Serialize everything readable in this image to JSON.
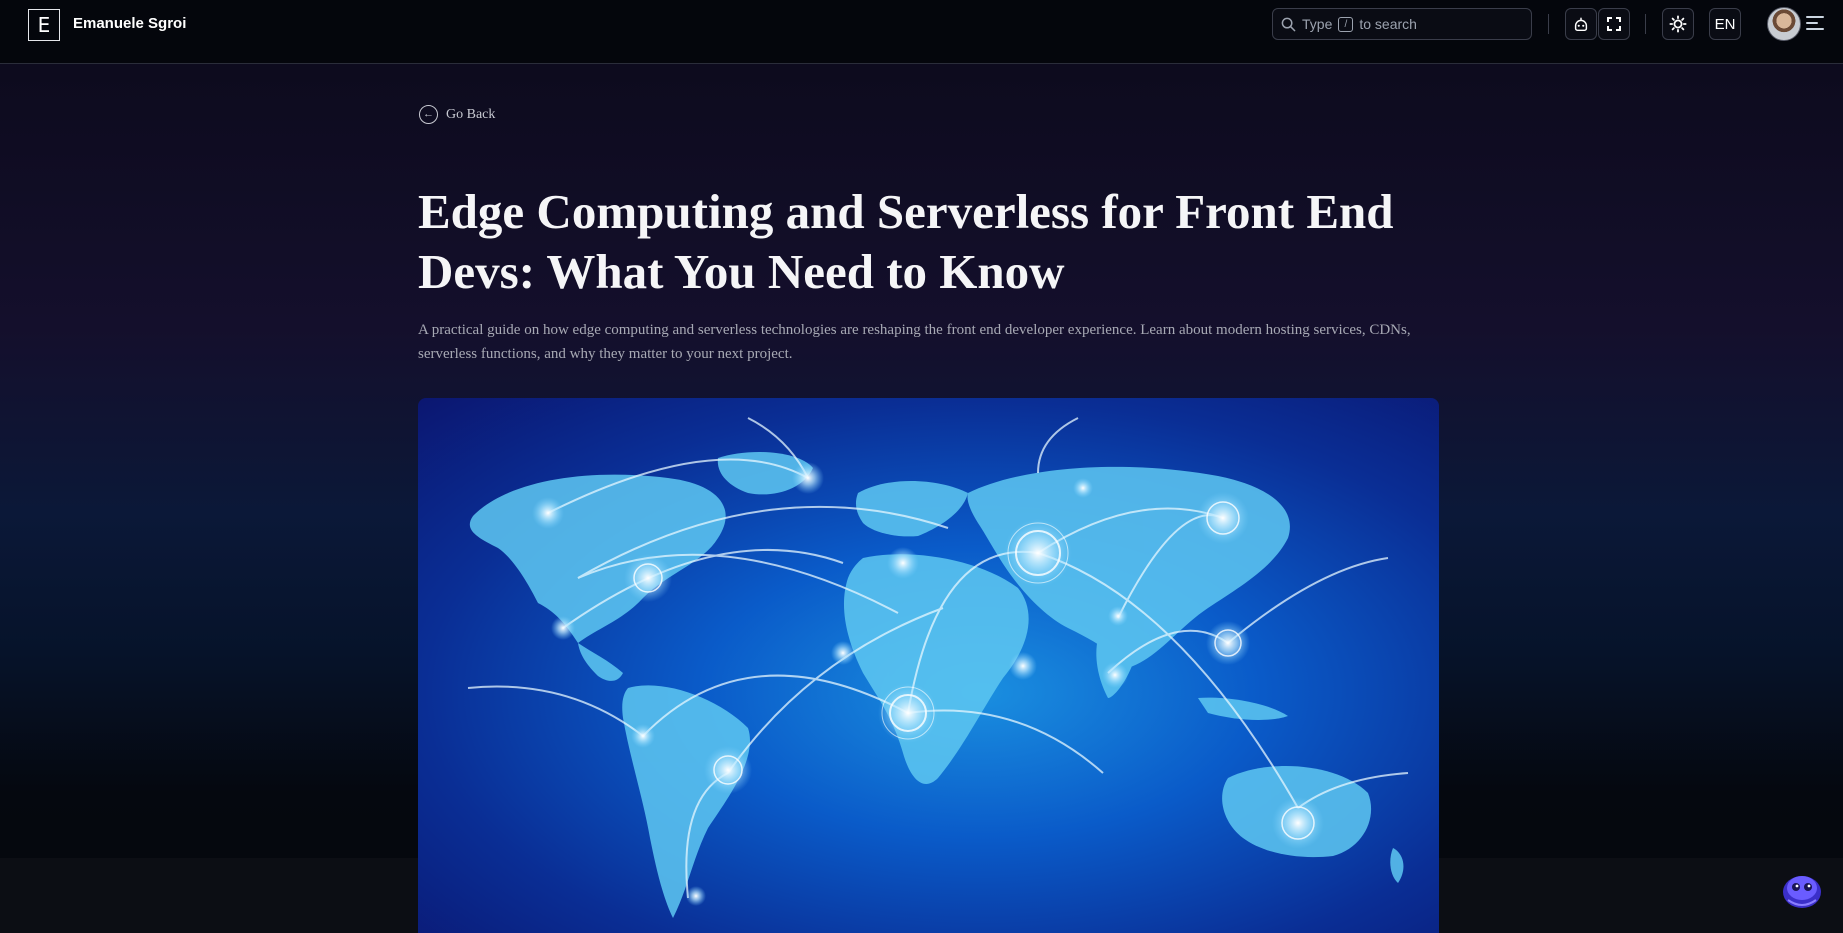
{
  "header": {
    "logo_letter": "E",
    "site_name": "Emanuele Sgroi",
    "search": {
      "prefix": "Type",
      "key": "/",
      "suffix": "to search"
    },
    "language": "EN"
  },
  "article": {
    "back_label": "Go Back",
    "title": "Edge Computing and Serverless for Front End Devs: What You Need to Know",
    "subtitle": "A practical guide on how edge computing and serverless technologies are reshaping the front end developer experience. Learn about modern hosting services, CDNs, serverless functions, and why they matter to your next project."
  },
  "icons": {
    "search": "search-icon",
    "ai_bot": "ai-bot-icon",
    "fullscreen": "fullscreen-icon",
    "theme": "sun-icon",
    "menu": "hamburger-menu-icon",
    "back": "arrow-left-circle-icon",
    "chat": "chat-bot-icon"
  },
  "colors": {
    "header_bg": "#04060c",
    "accent_blue": "#0a5bc9",
    "text_primary": "#f5f5f7",
    "text_muted": "#a7a9b4"
  }
}
